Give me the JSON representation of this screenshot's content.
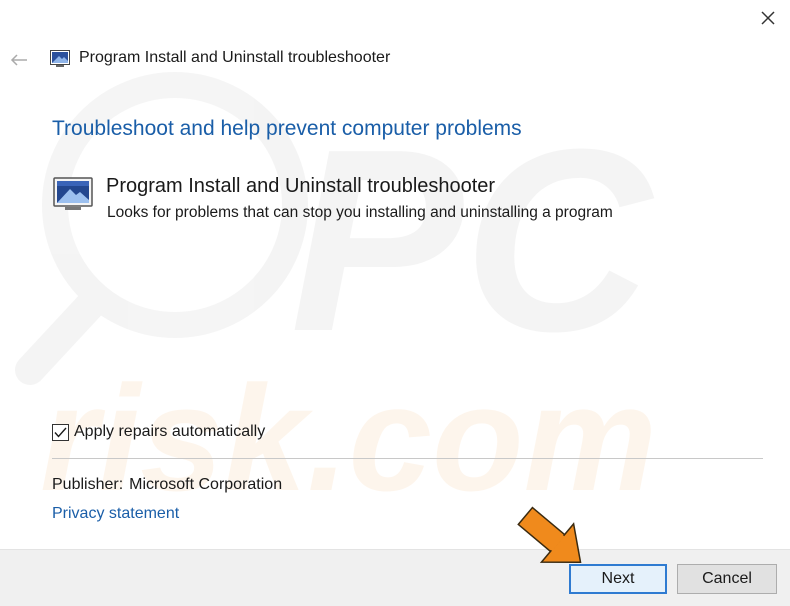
{
  "window": {
    "title": "Program Install and Uninstall troubleshooter",
    "close_icon": "close-icon",
    "back_icon": "back-arrow-icon",
    "title_icon": "troubleshooter-icon"
  },
  "main": {
    "heading": "Troubleshoot and help prevent computer problems",
    "tool": {
      "icon": "troubleshooter-icon",
      "name": "Program Install and Uninstall troubleshooter",
      "description": "Looks for problems that can stop you installing and uninstalling a program"
    },
    "apply_repairs": {
      "label": "Apply repairs automatically",
      "checked": true
    },
    "publisher_label": "Publisher:",
    "publisher_value": "Microsoft Corporation",
    "privacy_link": "Privacy statement"
  },
  "footer": {
    "next_label": "Next",
    "cancel_label": "Cancel"
  },
  "colors": {
    "heading_blue": "#1a5ea8",
    "link_blue": "#1a5ea8",
    "focus_border": "#2f7bd1",
    "annotation_arrow": "#f08a1c",
    "footer_bg": "#f0f0f0"
  },
  "watermark": {
    "top": "PC",
    "bottom": "risk.com"
  }
}
